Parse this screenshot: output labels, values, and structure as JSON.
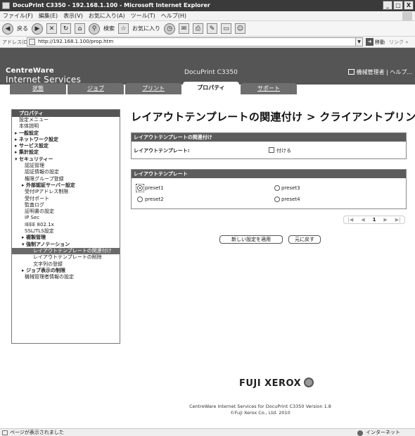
{
  "window": {
    "title": "DocuPrint C3350 - 192.168.1.100 - Microsoft Internet Explorer",
    "buttons": [
      "_",
      "□",
      "X"
    ]
  },
  "menu": [
    "ファイル(F)",
    "編集(E)",
    "表示(V)",
    "お気に入り(A)",
    "ツール(T)",
    "ヘルプ(H)"
  ],
  "toolbar": {
    "back": "戻る",
    "search": "検索",
    "favorites": "お気に入り"
  },
  "address": {
    "label": "アドレス(D)",
    "url": "http://192.168.1.100/prop.htm",
    "go": "移動",
    "links": "リンク »"
  },
  "header": {
    "brand_line1": "CentreWare",
    "brand_line2": "Internet Services",
    "model": "DocuPrint C3350",
    "user": "機械管理者 | ヘルプ..."
  },
  "tabs": [
    {
      "label": "状態",
      "active": false
    },
    {
      "label": "ジョブ",
      "active": false
    },
    {
      "label": "プリント",
      "active": false
    },
    {
      "label": "プロパティ",
      "active": true
    },
    {
      "label": "サポート",
      "active": false
    }
  ],
  "sidebar": {
    "heading": "プロパティ",
    "items": [
      {
        "label": "設定メニュー",
        "level": "l0"
      },
      {
        "label": "本体説明",
        "level": "l0"
      },
      {
        "label": "▸ 一般設定",
        "level": "l0b"
      },
      {
        "label": "▸ ネットワーク設定",
        "level": "l0b"
      },
      {
        "label": "▸ サービス設定",
        "level": "l0b"
      },
      {
        "label": "▸ 集計設定",
        "level": "l0b"
      },
      {
        "label": "▾ セキュリティー",
        "level": "l0b"
      },
      {
        "label": "認証管理",
        "level": "l1"
      },
      {
        "label": "認証情報の設定",
        "level": "l1"
      },
      {
        "label": "権限グループ登録",
        "level": "l1"
      },
      {
        "label": "▸ 外部認証サーバー設定",
        "level": "l1b"
      },
      {
        "label": "受付IPアドレス制限",
        "level": "l1"
      },
      {
        "label": "受付ポート",
        "level": "l1"
      },
      {
        "label": "監査ログ",
        "level": "l1"
      },
      {
        "label": "証明書の設定",
        "level": "l1"
      },
      {
        "label": "IP Sec",
        "level": "l1"
      },
      {
        "label": "IEEE 802.1x",
        "level": "l1"
      },
      {
        "label": "SSL/TLS設定",
        "level": "l1"
      },
      {
        "label": "▸ 複製管理",
        "level": "l1b"
      },
      {
        "label": "▾ 強制アノテーション",
        "level": "l1b"
      },
      {
        "label": "レイアウトテンプレートの関連付け",
        "level": "l2",
        "selected": true
      },
      {
        "label": "レイアウトテンプレートの削除",
        "level": "l2"
      },
      {
        "label": "文字列の登録",
        "level": "l2"
      },
      {
        "label": "▸ ジョブ表示の制限",
        "level": "l1b"
      },
      {
        "label": "機械管理者情報の設定",
        "level": "l1"
      }
    ]
  },
  "main": {
    "title": "レイアウトテンプレートの関連付け > クライアントプリント",
    "assoc_section": {
      "heading": "レイアウトテンプレートの関連付け",
      "row_label": "レイアウトテンプレート:",
      "checkbox_label": "付ける",
      "checked": false
    },
    "template_section": {
      "heading": "レイアウトテンプレート",
      "options": [
        {
          "label": "preset1",
          "selected": true
        },
        {
          "label": "preset3",
          "selected": false
        },
        {
          "label": "preset2",
          "selected": false
        },
        {
          "label": "preset4",
          "selected": false
        }
      ]
    },
    "pager": {
      "first": "|◀",
      "prev": "◀",
      "page": "1",
      "next": "▶",
      "last": "▶|"
    },
    "apply_button": "新しい設定を適用",
    "reset_button": "元に戻す"
  },
  "footer": {
    "logo": "FUJI XEROX",
    "line1": "CentreWare Internet Services for DocuPrint C3350 Version 1.8",
    "line2": "©Fuji Xerox Co., Ltd. 2010"
  },
  "status": {
    "text": "ページが表示されました",
    "zone": "インターネット"
  }
}
